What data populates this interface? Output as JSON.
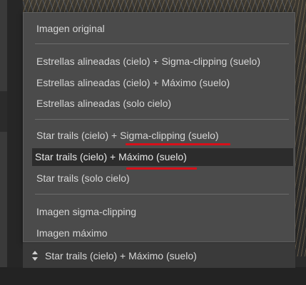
{
  "dropdown": {
    "options": [
      {
        "label": "Imagen original"
      },
      {
        "label": "Estrellas alineadas (cielo) + Sigma-clipping (suelo)"
      },
      {
        "label": "Estrellas alineadas (cielo) + Máximo (suelo)"
      },
      {
        "label": "Estrellas alineadas (solo cielo)"
      },
      {
        "label": "Star trails (cielo) + Sigma-clipping (suelo)"
      },
      {
        "label": "Star trails (cielo) + Máximo (suelo)"
      },
      {
        "label": "Star trails (solo cielo)"
      },
      {
        "label": "Imagen sigma-clipping"
      },
      {
        "label": "Imagen máximo"
      }
    ],
    "selected_index": 5
  },
  "combo": {
    "value": "Star trails (cielo) + Máximo (suelo)",
    "icon": "up-down-arrows-icon"
  },
  "colors": {
    "popup_bg": "#4b4b4b",
    "selected_bg": "#2c2c2c",
    "text": "#d6d6d6",
    "annotation_underline": "#d8101a"
  }
}
